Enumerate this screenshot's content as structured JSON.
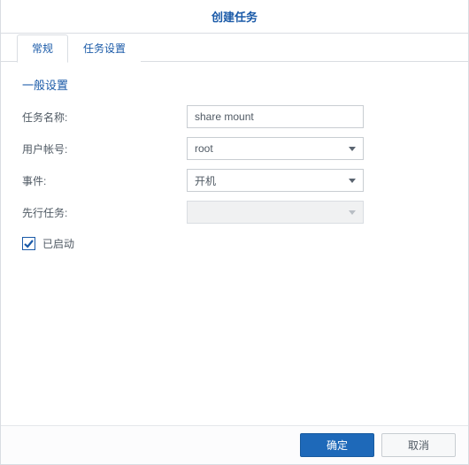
{
  "header": {
    "title": "创建任务"
  },
  "tabs": {
    "general": "常规",
    "task_settings": "任务设置"
  },
  "section": {
    "title": "一般设置"
  },
  "form": {
    "task_name_label": "任务名称:",
    "task_name_value": "share mount",
    "user_label": "用户帐号:",
    "user_value": "root",
    "event_label": "事件:",
    "event_value": "开机",
    "pretask_label": "先行任务:",
    "pretask_value": ""
  },
  "checkbox": {
    "enabled_label": "已启动"
  },
  "footer": {
    "ok": "确定",
    "cancel": "取消"
  }
}
